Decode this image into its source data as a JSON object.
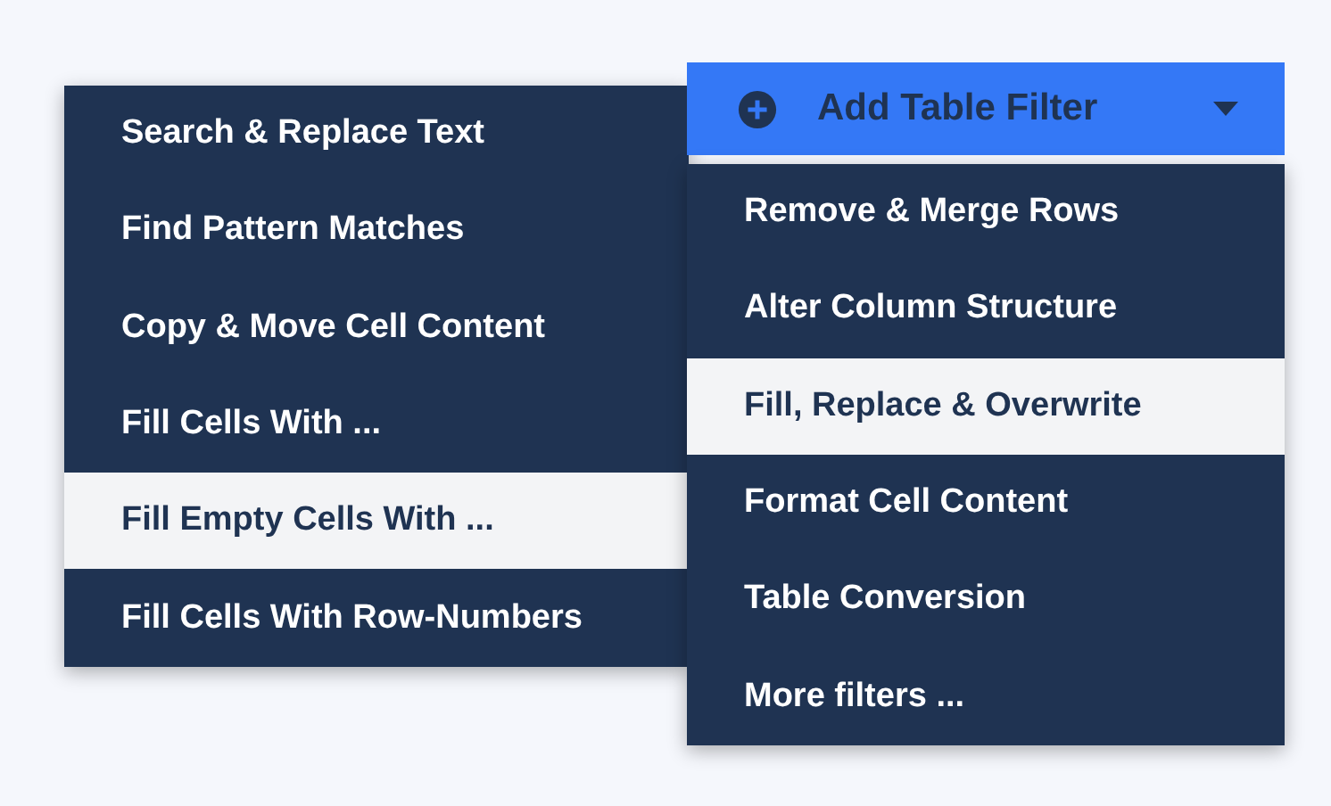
{
  "submenu": {
    "items": [
      {
        "label": "Search & Replace Text",
        "selected": false
      },
      {
        "label": "Find Pattern Matches",
        "selected": false
      },
      {
        "label": "Copy & Move Cell Content",
        "selected": false
      },
      {
        "label": "Fill Cells With ...",
        "selected": false
      },
      {
        "label": "Fill Empty Cells With ...",
        "selected": true
      },
      {
        "label": "Fill Cells With Row-Numbers",
        "selected": false
      }
    ]
  },
  "add_filter_button": {
    "label": "Add Table Filter"
  },
  "menu": {
    "items": [
      {
        "label": "Remove & Merge Rows",
        "selected": false
      },
      {
        "label": "Alter Column Structure",
        "selected": false
      },
      {
        "label": "Fill, Replace & Overwrite",
        "selected": true
      },
      {
        "label": "Format Cell Content",
        "selected": false
      },
      {
        "label": "Table Conversion",
        "selected": false
      },
      {
        "label": "More filters ...",
        "selected": false
      }
    ]
  }
}
